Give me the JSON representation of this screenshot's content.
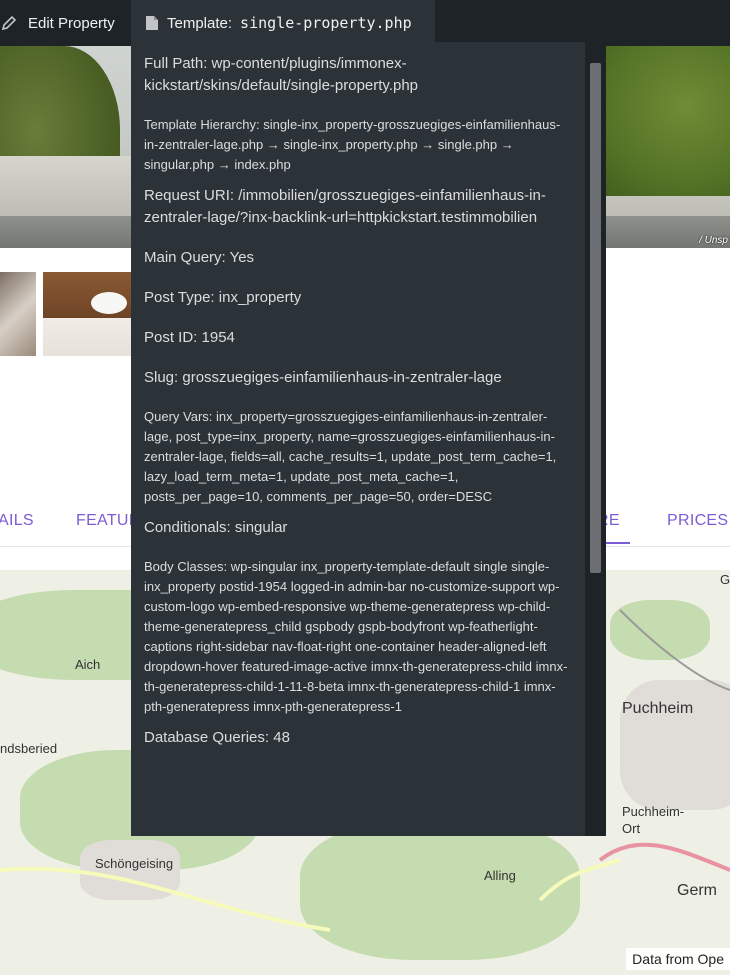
{
  "adminbar": {
    "edit_label": "Edit Property",
    "edit_icon": "pencil-icon",
    "template_prefix": "Template: ",
    "template_file": "single-property.php",
    "template_icon": "file-icon"
  },
  "hero": {
    "credit": "/ Unsp"
  },
  "tabs": [
    "AILS",
    "FEATUR",
    "RE",
    "PRICES"
  ],
  "map": {
    "labels": [
      "Aich",
      "ndsberied",
      "Puchheim",
      "Puchheim-Ort",
      "Schöngeising",
      "Alling",
      "Germ",
      "G"
    ],
    "attribution": "Data from Ope"
  },
  "panel": {
    "full_path": "Full Path: wp-content/plugins/immonex-kickstart/skins/default/single-property.php",
    "template_hierarchy": "Template Hierarchy: single-inx_property-grosszuegiges-einfamilienhaus-in-zentraler-lage.php → single-inx_property.php → single.php → singular.php → index.php",
    "request_uri": "Request URI: /immobilien/grosszuegiges-einfamilienhaus-in-zentraler-lage/?inx-backlink-url=httpkickstart.testimmobilien",
    "main_query": "Main Query: Yes",
    "post_type": "Post Type: inx_property",
    "post_id": "Post ID: 1954",
    "slug": "Slug: grosszuegiges-einfamilienhaus-in-zentraler-lage",
    "query_vars": "Query Vars: inx_property=grosszuegiges-einfamilienhaus-in-zentraler-lage, post_type=inx_property, name=grosszuegiges-einfamilienhaus-in-zentraler-lage, fields=all, cache_results=1, update_post_term_cache=1, lazy_load_term_meta=1, update_post_meta_cache=1, posts_per_page=10, comments_per_page=50, order=DESC",
    "conditionals": "Conditionals: singular",
    "body_classes": "Body Classes: wp-singular inx_property-template-default single single-inx_property postid-1954 logged-in admin-bar no-customize-support wp-custom-logo wp-embed-responsive wp-theme-generatepress wp-child-theme-generatepress_child gspbody gspb-bodyfront wp-featherlight-captions right-sidebar nav-float-right one-container header-aligned-left dropdown-hover featured-image-active imnx-th-generatepress-child imnx-th-generatepress-child-1-11-8-beta imnx-th-generatepress-child-1 imnx-pth-generatepress imnx-pth-generatepress-1",
    "db_queries": "Database Queries: 48"
  }
}
